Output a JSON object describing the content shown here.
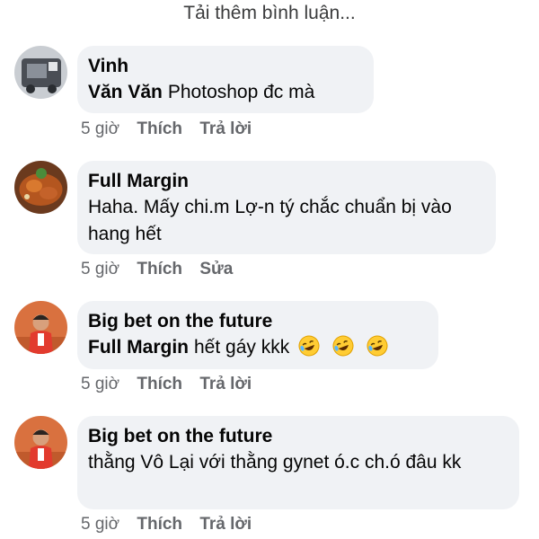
{
  "load_more": "Tải thêm bình luận...",
  "comments": [
    {
      "author": "Vinh",
      "mention": "Văn Văn",
      "text": "Photoshop đc mà",
      "time": "5 giờ",
      "like": "Thích",
      "action2": "Trả lời",
      "avatar_icon": "vehicle-photo-avatar"
    },
    {
      "author": "Full Margin",
      "mention": "",
      "text": "Haha. Mấy chi.m Lợ-n tý chắc chuẩn bị vào hang hết",
      "time": "5 giờ",
      "like": "Thích",
      "action2": "Sửa",
      "avatar_icon": "food-photo-avatar"
    },
    {
      "author": "Big bet on the future",
      "mention": "Full Margin",
      "text": "hết gáy kkk",
      "emoji": [
        "rofl-emoji",
        "rofl-emoji",
        "rofl-emoji"
      ],
      "time": "5 giờ",
      "like": "Thích",
      "action2": "Trả lời",
      "avatar_icon": "tennis-player-avatar"
    },
    {
      "author": "Big bet on the future",
      "mention": "",
      "text": "thằng Vô Lại với thằng gynet ó.c ch.ó đâu kk",
      "time": "5 giờ",
      "like": "Thích",
      "action2": "Trả lời",
      "avatar_icon": "tennis-player-avatar"
    }
  ],
  "colors": {
    "bubble": "#f0f2f5",
    "meta": "#65676b",
    "text": "#050505"
  }
}
